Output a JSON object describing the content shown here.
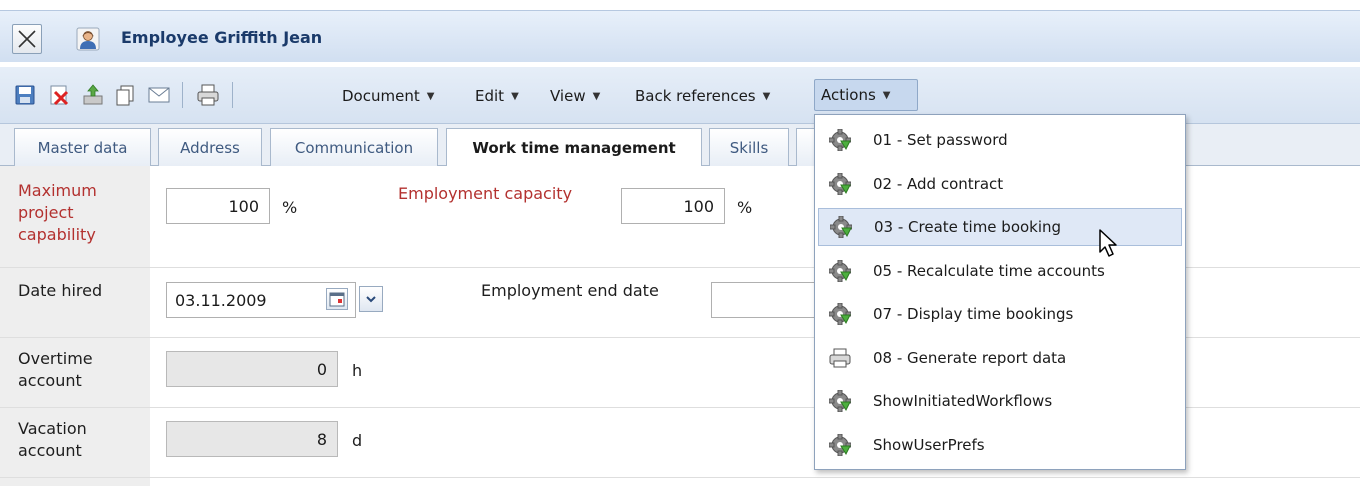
{
  "window": {
    "title": "Employee Griffith Jean",
    "close_icon": "close-icon",
    "user_icon": "employee-icon"
  },
  "toolbar": {
    "icons": [
      "save-icon",
      "delete-icon",
      "export-icon",
      "copy-icon",
      "mail-icon",
      "print-icon"
    ],
    "menus": {
      "document": "Document",
      "edit": "Edit",
      "view": "View",
      "back_references": "Back references",
      "actions": "Actions"
    }
  },
  "tabs": {
    "master_data": "Master data",
    "address": "Address",
    "communication": "Communication",
    "work_time_management": "Work time management",
    "skills": "Skills",
    "active": "Work time management"
  },
  "form": {
    "max_project_capability": {
      "label_line1": "Maximum",
      "label_line2": "project",
      "label_line3": "capability",
      "value": "100",
      "unit": "%"
    },
    "employment_capacity": {
      "label": "Employment capacity",
      "value": "100",
      "unit": "%"
    },
    "date_hired": {
      "label": "Date hired",
      "value": "03.11.2009"
    },
    "employment_end_date": {
      "label": "Employment end date",
      "value": ""
    },
    "overtime_account": {
      "label_line1": "Overtime",
      "label_line2": "account",
      "value": "0",
      "unit": "h"
    },
    "vacation_account": {
      "label_line1": "Vacation",
      "label_line2": "account",
      "value": "8",
      "unit": "d"
    }
  },
  "actions_menu": {
    "items": [
      {
        "label": "01 - Set password",
        "icon": "gear-icon"
      },
      {
        "label": "02 - Add contract",
        "icon": "gear-icon"
      },
      {
        "label": "03 - Create time booking",
        "icon": "gear-icon",
        "hovered": true
      },
      {
        "label": "05 - Recalculate time accounts",
        "icon": "gear-icon"
      },
      {
        "label": "07 - Display time bookings",
        "icon": "gear-icon"
      },
      {
        "label": "08 - Generate report data",
        "icon": "print-icon"
      },
      {
        "label": "ShowInitiatedWorkflows",
        "icon": "gear-icon"
      },
      {
        "label": "ShowUserPrefs",
        "icon": "gear-icon"
      }
    ]
  },
  "colors": {
    "required_label": "#b3312f",
    "title_text": "#1a3a6a",
    "hover_bg": "#dfe8f6"
  }
}
